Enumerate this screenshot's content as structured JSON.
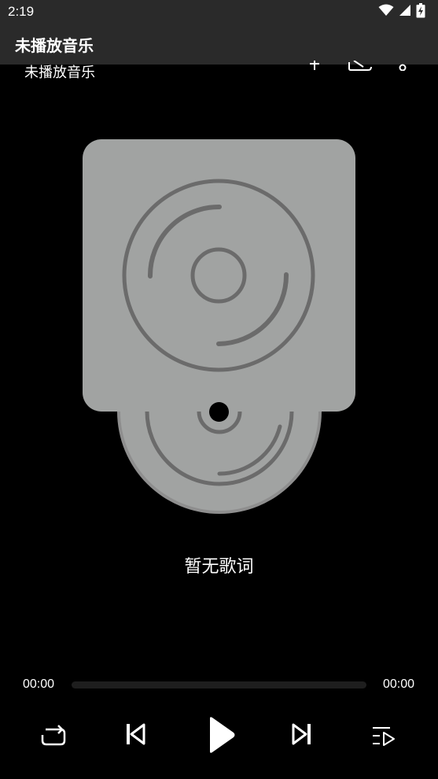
{
  "status_bar": {
    "time": "2:19",
    "icons": [
      "wifi-icon",
      "cell-signal-icon",
      "battery-charging-icon"
    ]
  },
  "app_bar": {
    "title": "未播放音乐"
  },
  "now_playing": {
    "title": "未播放音乐"
  },
  "lyrics": {
    "text": "暂无歌词"
  },
  "progress": {
    "current": "00:00",
    "total": "00:00",
    "fraction": 0
  },
  "controls": {
    "icons": [
      "repeat-icon",
      "previous-icon",
      "play-icon",
      "next-icon",
      "playlist-icon"
    ]
  },
  "colors": {
    "background": "#000000",
    "bar": "#2a2a2a",
    "cover": "#a1a3a2",
    "disc_lines": "#6b6b6b",
    "text": "#ffffff"
  }
}
